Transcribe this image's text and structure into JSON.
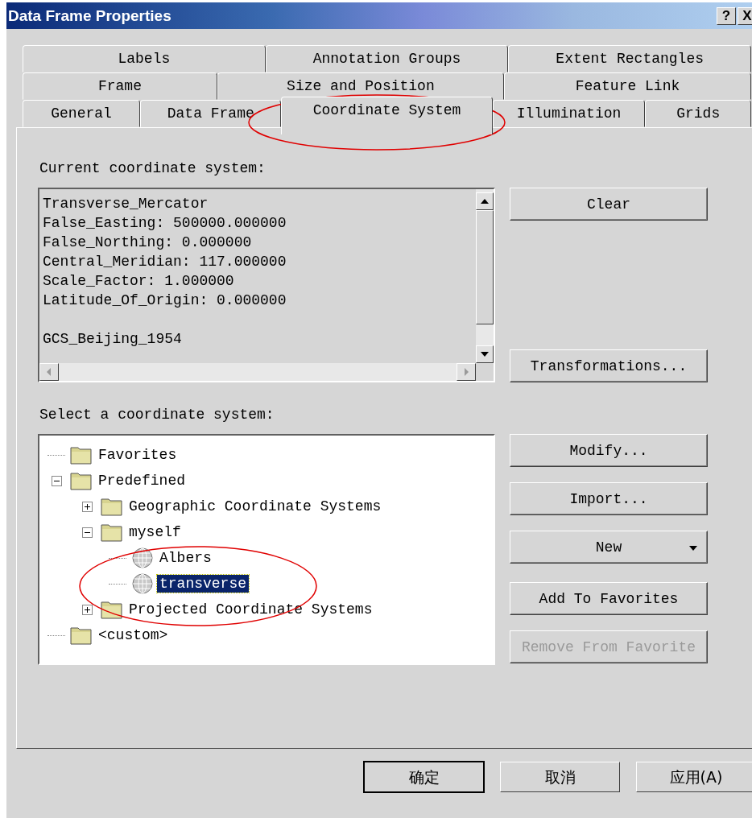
{
  "window": {
    "title": "Data Frame Properties",
    "title_buttons": [
      "?",
      "X"
    ]
  },
  "tab_rows": [
    [
      {
        "label": "Labels",
        "selected": false
      },
      {
        "label": "Annotation Groups",
        "selected": false
      },
      {
        "label": "Extent Rectangles",
        "selected": false
      }
    ],
    [
      {
        "label": "Frame",
        "selected": false
      },
      {
        "label": "Size and Position",
        "selected": false
      },
      {
        "label": "Feature Link",
        "selected": false
      }
    ],
    [
      {
        "label": "General",
        "selected": false
      },
      {
        "label": "Data Frame",
        "selected": false
      },
      {
        "label": "Coordinate System",
        "selected": true
      },
      {
        "label": "Illumination",
        "selected": false
      },
      {
        "label": "Grids",
        "selected": false
      }
    ]
  ],
  "current": {
    "label": "Current coordinate system:",
    "lines": [
      "Transverse_Mercator",
      "False_Easting: 500000.000000",
      "False_Northing: 0.000000",
      "Central_Meridian: 117.000000",
      "Scale_Factor: 1.000000",
      "Latitude_Of_Origin: 0.000000"
    ],
    "datum_lines": [
      "GCS_Beijing_1954"
    ],
    "buttons": [
      {
        "label": "Clear",
        "disabled": false
      },
      {
        "label": "Transformations...",
        "disabled": false
      }
    ]
  },
  "select": {
    "label": "Select a coordinate system:",
    "tree": [
      {
        "label": "Favorites",
        "kind": "folder",
        "selected": false
      },
      {
        "label": "Predefined",
        "kind": "folder",
        "selected": false,
        "expanded": true,
        "children": [
          {
            "label": "Geographic Coordinate Systems",
            "kind": "folder",
            "selected": false,
            "expanded": false
          },
          {
            "label": "myself",
            "kind": "folder",
            "selected": false,
            "expanded": true,
            "children": [
              {
                "label": "Albers",
                "kind": "globe",
                "selected": false
              },
              {
                "label": "transverse",
                "kind": "globe",
                "selected": true
              }
            ]
          },
          {
            "label": "Projected Coordinate Systems",
            "kind": "folder",
            "selected": false,
            "expanded": false
          }
        ]
      },
      {
        "label": "<custom>",
        "kind": "folder",
        "selected": false
      }
    ],
    "buttons": [
      {
        "label": "Modify...",
        "disabled": false
      },
      {
        "label": "Import...",
        "disabled": false
      },
      {
        "label": "New",
        "disabled": false,
        "dropdown": true
      },
      {
        "label": "Add To Favorites",
        "disabled": false
      },
      {
        "label": "Remove From Favorite",
        "disabled": true
      }
    ]
  },
  "dialog_buttons": [
    {
      "label": "确定",
      "default": true
    },
    {
      "label": "取消",
      "default": false
    },
    {
      "label": "应用(A)",
      "default": false
    }
  ],
  "annotations": [
    {
      "kind": "ellipse"
    },
    {
      "kind": "ellipse"
    }
  ]
}
